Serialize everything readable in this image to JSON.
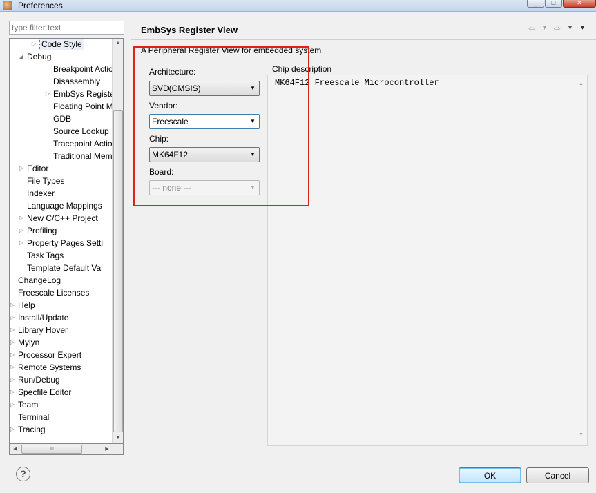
{
  "window": {
    "title": "Preferences"
  },
  "filter": {
    "placeholder": "type filter text"
  },
  "tree": {
    "items": [
      {
        "label": "Code Style",
        "arrow": "▷",
        "selected": true
      },
      {
        "label": "Debug",
        "arrow": "◢"
      },
      {
        "label": "Breakpoint Actio",
        "arrow": ""
      },
      {
        "label": "Disassembly",
        "arrow": ""
      },
      {
        "label": "EmbSys Register",
        "arrow": "▷"
      },
      {
        "label": "Floating Point M",
        "arrow": ""
      },
      {
        "label": "GDB",
        "arrow": ""
      },
      {
        "label": "Source Lookup P",
        "arrow": ""
      },
      {
        "label": "Tracepoint Actio",
        "arrow": ""
      },
      {
        "label": "Traditional Mem",
        "arrow": ""
      },
      {
        "label": "Editor",
        "arrow": "▷"
      },
      {
        "label": "File Types",
        "arrow": ""
      },
      {
        "label": "Indexer",
        "arrow": ""
      },
      {
        "label": "Language Mappings",
        "arrow": ""
      },
      {
        "label": "New C/C++ Project",
        "arrow": "▷"
      },
      {
        "label": "Profiling",
        "arrow": "▷"
      },
      {
        "label": "Property Pages Setti",
        "arrow": "▷"
      },
      {
        "label": "Task Tags",
        "arrow": ""
      },
      {
        "label": "Template Default Va",
        "arrow": ""
      },
      {
        "label": "ChangeLog",
        "arrow": ""
      },
      {
        "label": "Freescale Licenses",
        "arrow": ""
      },
      {
        "label": "Help",
        "arrow": "▷"
      },
      {
        "label": "Install/Update",
        "arrow": "▷"
      },
      {
        "label": "Library Hover",
        "arrow": "▷"
      },
      {
        "label": "Mylyn",
        "arrow": "▷"
      },
      {
        "label": "Processor Expert",
        "arrow": "▷"
      },
      {
        "label": "Remote Systems",
        "arrow": "▷"
      },
      {
        "label": "Run/Debug",
        "arrow": "▷"
      },
      {
        "label": "Specfile Editor",
        "arrow": "▷"
      },
      {
        "label": "Team",
        "arrow": "▷"
      },
      {
        "label": "Terminal",
        "arrow": ""
      },
      {
        "label": "Tracing",
        "arrow": "▷"
      }
    ],
    "hscroll_grip": "III"
  },
  "page": {
    "title": "EmbSys Register View",
    "description": "A Peripheral Register View for embedded system",
    "nav": {
      "back": "⇦",
      "back_menu": "▾",
      "forward": "⇨",
      "forward_menu": "▾",
      "view_menu": "▾"
    },
    "architecture": {
      "label": "Architecture:",
      "value": "SVD(CMSIS)"
    },
    "vendor": {
      "label": "Vendor:",
      "value": "Freescale"
    },
    "chip": {
      "label": "Chip:",
      "value": "MK64F12"
    },
    "board": {
      "label": "Board:",
      "value": "---  none ---"
    },
    "chip_description": {
      "label": "Chip description",
      "text": "MK64F12 Freescale Microcontroller"
    }
  },
  "buttons": {
    "ok": "OK",
    "cancel": "Cancel",
    "help": "?"
  },
  "colors": {
    "highlight": "#e0201a",
    "ok_border": "#3c7fb1"
  },
  "icons": {
    "app": "preferences-app-icon",
    "dropdown": "▼",
    "scroll_up": "▲",
    "scroll_down": "▼",
    "scroll_left": "◀",
    "scroll_right": "▶"
  }
}
